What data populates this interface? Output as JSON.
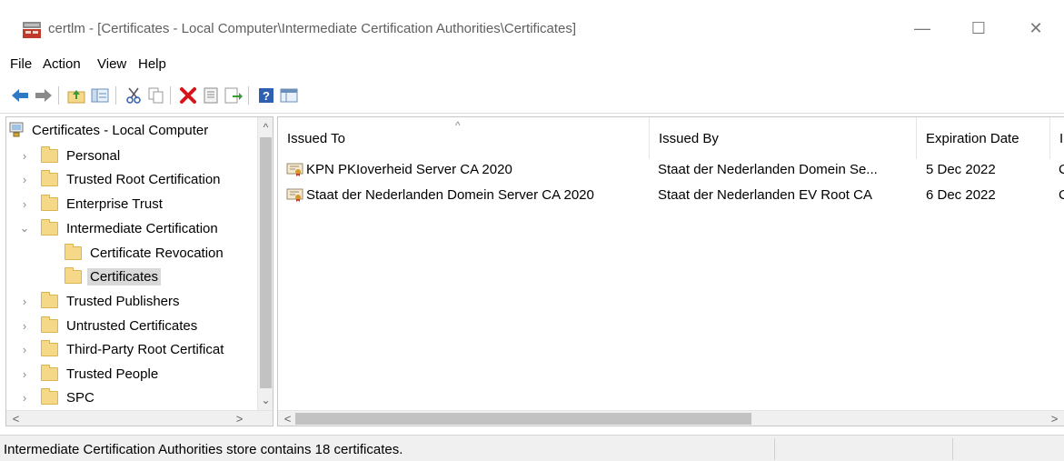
{
  "window": {
    "title": "certlm - [Certificates - Local Computer\\Intermediate Certification Authorities\\Certificates]",
    "minimize_glyph": "—",
    "maximize_glyph": "☐",
    "close_glyph": "✕"
  },
  "menu": [
    "File",
    "Action",
    "View",
    "Help"
  ],
  "toolbar": {
    "icons": [
      "back-icon",
      "forward-icon",
      "up-folder-icon",
      "show-hide-tree-icon",
      "cut-icon",
      "copy-icon",
      "delete-icon",
      "properties-icon",
      "export-list-icon",
      "help-icon",
      "view-icon"
    ]
  },
  "tree": {
    "items": [
      {
        "label": "Certificates - Local Computer",
        "chevron": ""
      },
      {
        "label": "Personal",
        "chevron": "›"
      },
      {
        "label": "Trusted Root Certification",
        "chevron": "›"
      },
      {
        "label": "Enterprise Trust",
        "chevron": "›"
      },
      {
        "label": "Intermediate Certification",
        "chevron": "⌄"
      },
      {
        "label": "Certificate Revocation",
        "chevron": ""
      },
      {
        "label": "Certificates",
        "chevron": "",
        "selected": true
      },
      {
        "label": "Trusted Publishers",
        "chevron": "›"
      },
      {
        "label": "Untrusted Certificates",
        "chevron": "›"
      },
      {
        "label": "Third-Party Root Certificat",
        "chevron": "›"
      },
      {
        "label": "Trusted People",
        "chevron": "›"
      },
      {
        "label": "SPC",
        "chevron": "›"
      }
    ],
    "scroll_up": "^",
    "scroll_down": "⌄",
    "scroll_left": "<",
    "scroll_right": ">"
  },
  "list": {
    "columns": [
      "Issued To",
      "Issued By",
      "Expiration Date",
      "I"
    ],
    "sort_glyph": "^",
    "rows": [
      {
        "issued_to": "KPN PKIoverheid Server CA 2020",
        "issued_by": "Staat der Nederlanden Domein Se...",
        "expiration": "5 Dec 2022",
        "extra": "C"
      },
      {
        "issued_to": "Staat der Nederlanden Domein Server CA 2020",
        "issued_by": "Staat der Nederlanden EV Root CA",
        "expiration": "6 Dec 2022",
        "extra": "C"
      }
    ],
    "scroll_left": "<",
    "scroll_right": ">"
  },
  "status": {
    "text": "Intermediate Certification Authorities store contains 18 certificates."
  },
  "colors": {
    "folder": "#f6d889",
    "delete_red": "#d7141a",
    "arrow_blue": "#2f78c4",
    "selection_gray": "#d9d9d9"
  }
}
